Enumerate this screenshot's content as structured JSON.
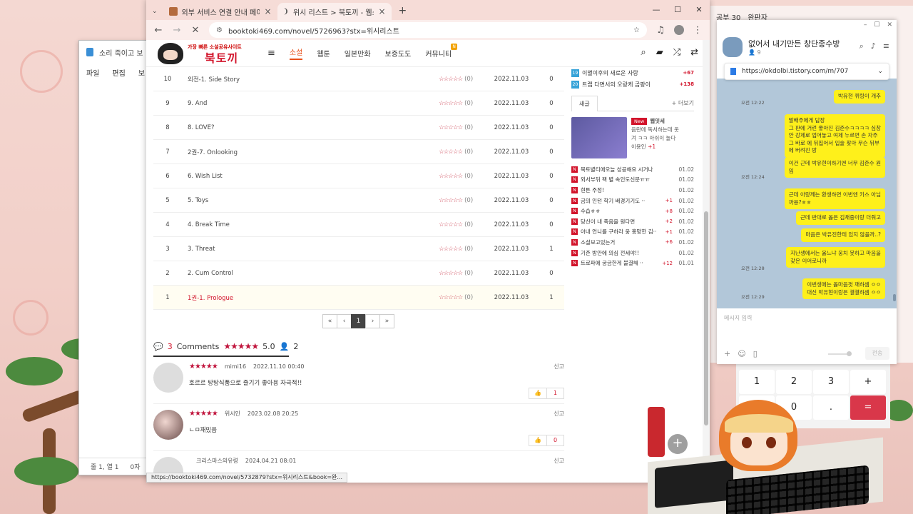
{
  "notepad": {
    "title": "소리 죽이고 보",
    "menu": [
      "파일",
      "편집",
      "보"
    ],
    "status": [
      "줄 1, 열 1",
      "0자"
    ]
  },
  "browser": {
    "tabs": [
      {
        "title": "외부 서비스 연결 안내 페이지"
      },
      {
        "title": "위시 리스트 > 북토끼 - 웹소설"
      }
    ],
    "window_controls": [
      "—",
      "☐",
      "✕"
    ],
    "url": "booktoki469.com/novel/5726963?stx=위시리스트",
    "status_url": "https://booktoki469.com/novel/5732879?stx=위시리스트&book=완..."
  },
  "site": {
    "logo_small": "가장 빠른 소설공유사이트",
    "logo_big": "북토끼",
    "nav": [
      "소설",
      "웹툰",
      "일본만화",
      "보증도도",
      "커뮤니티"
    ],
    "nav_badge": "N"
  },
  "episodes": [
    {
      "num": "10",
      "title": "외전-1. Side Story",
      "stars": "☆☆☆☆☆",
      "score": "(0)",
      "date": "2022.11.03",
      "count": "0",
      "current": false
    },
    {
      "num": "9",
      "title": "9. And",
      "stars": "☆☆☆☆☆",
      "score": "(0)",
      "date": "2022.11.03",
      "count": "0",
      "current": false
    },
    {
      "num": "8",
      "title": "8. LOVE?",
      "stars": "☆☆☆☆☆",
      "score": "(0)",
      "date": "2022.11.03",
      "count": "0",
      "current": false
    },
    {
      "num": "7",
      "title": "2권-7. Onlooking",
      "stars": "☆☆☆☆☆",
      "score": "(0)",
      "date": "2022.11.03",
      "count": "0",
      "current": false
    },
    {
      "num": "6",
      "title": "6. Wish List",
      "stars": "☆☆☆☆☆",
      "score": "(0)",
      "date": "2022.11.03",
      "count": "0",
      "current": false
    },
    {
      "num": "5",
      "title": "5. Toys",
      "stars": "☆☆☆☆☆",
      "score": "(0)",
      "date": "2022.11.03",
      "count": "0",
      "current": false
    },
    {
      "num": "4",
      "title": "4. Break Time",
      "stars": "☆☆☆☆☆",
      "score": "(0)",
      "date": "2022.11.03",
      "count": "0",
      "current": false
    },
    {
      "num": "3",
      "title": "3. Threat",
      "stars": "☆☆☆☆☆",
      "score": "(0)",
      "date": "2022.11.03",
      "count": "1",
      "current": false
    },
    {
      "num": "2",
      "title": "2. Cum Control",
      "stars": "☆☆☆☆☆",
      "score": "(0)",
      "date": "2022.11.03",
      "count": "0",
      "current": false
    },
    {
      "num": "1",
      "title": "1권-1. Prologue",
      "stars": "☆☆☆☆☆",
      "score": "(0)",
      "date": "2022.11.03",
      "count": "1",
      "current": true
    }
  ],
  "pager": [
    "«",
    "‹",
    "1",
    "›",
    "»"
  ],
  "comments_header": {
    "count": "3",
    "label": "Comments",
    "stars": "★★★★★",
    "score": "5.0",
    "people": "2"
  },
  "comments": [
    {
      "stars": "★★★★★",
      "user": "mimi16",
      "date": "2022.11.10 00:40",
      "text": "호르르 탕탕식품으로 즐기기 좋아용 자극적!!",
      "report": "신고",
      "likes": "1"
    },
    {
      "stars": "★★★★★",
      "user": "위시인",
      "date": "2023.02.08 20:25",
      "text": "ㄴㅁ재밌음",
      "report": "신고",
      "likes": "0"
    },
    {
      "stars": "",
      "user": "크리스마스의유령",
      "date": "2024.04.21 08:01",
      "text": "",
      "report": "신고",
      "likes": ""
    }
  ],
  "sidebar": {
    "rank": [
      {
        "no": "19",
        "title": "이별이후의 새로운 사랑",
        "up": "+67"
      },
      {
        "no": "20",
        "title": "트랩 다면서의 오랑케 곰팡이",
        "up": "+138"
      }
    ],
    "tab": "새글",
    "more": "+ 더보기",
    "featured": {
      "badge": "New",
      "title": "웹잇세",
      "line1": "음란에 독서하는데 옷",
      "line2": "겨 ㅋㅋ 아쉬이 놀다",
      "user": "이용인",
      "plus": "+1"
    },
    "posts": [
      {
        "title": "북토별티에오늘 성공해요 시거나",
        "rc": "",
        "date": "01.02"
      },
      {
        "title": "외서부뒤 팩 별 속인도신문ㅠㅠ",
        "rc": "",
        "date": "01.02"
      },
      {
        "title": "현튼 주정!",
        "rc": "",
        "date": "01.02"
      },
      {
        "title": "금의 인턴 학기 배경기기도 ··",
        "rc": "+1",
        "date": "01.02"
      },
      {
        "title": "수습ㅎㅎ",
        "rc": "+8",
        "date": "01.02"
      },
      {
        "title": "당신이 내 죽음을 원다면",
        "rc": "+2",
        "date": "01.02"
      },
      {
        "title": "아내 언니를 구하라 웅 홍망한 김··",
        "rc": "+1",
        "date": "01.02"
      },
      {
        "title": "소설보고있는거",
        "rc": "+6",
        "date": "01.02"
      },
      {
        "title": "기존 방안에 의심 전세야!!",
        "rc": "",
        "date": "01.02"
      },
      {
        "title": "트로파에 궁금한게 불결해 ··",
        "rc": "+12",
        "date": "01.01"
      }
    ]
  },
  "calculator": {
    "keys": [
      "1",
      "2",
      "3",
      "+",
      "",
      "0",
      ".",
      "="
    ]
  },
  "bgwin": {
    "tabs": [
      "공부 30",
      "완판자"
    ]
  },
  "chat": {
    "window_controls": [
      "–",
      "☐",
      "✕"
    ],
    "name": "없어서 내기만든 창단종수방",
    "members": "9",
    "link": "https://okdolbi.tistory.com/m/707",
    "messages": [
      {
        "text": "박유현 퀴링이 개추",
        "time": "오전 12:22"
      },
      {
        "text": "말배주에게 답장\n그 판에 거런 좋아진 김준수ㅋㅋㅋㅋ 심창\n안 강제로 업어놓고 여제 누르면 손 자주\n그 바로 에 뒤집어서 입술 찾아 무슨 뒤부\n에 버려진 방",
        "time": ""
      },
      {
        "text": "이건 근데 박유현이하기엔 너무 김준수 원\n임",
        "time": "오전 12:24"
      },
      {
        "text": "근데 아랑께는 환생하면 이번엔 키스 아님\n까용?ㅎㅎ",
        "time": ""
      },
      {
        "text": "근데 반대로 옳은 김채중이랑 더줘고",
        "time": ""
      },
      {
        "text": "마음은 박유진한테 있지 않을까..?",
        "time": ""
      },
      {
        "text": "지난생에서는 옳느냐 웅치 못하고 마음을\n갖은 이어로니까",
        "time": "오전 12:28"
      },
      {
        "text": "이번생에는 옳마음껏 깨하셈 ㅇㅇ\n대신 박유현이랑은 결결하셈 ㅇㅇ",
        "time": "오전 12:29"
      }
    ],
    "placeholder": "메시지 입력",
    "send": "전송"
  }
}
